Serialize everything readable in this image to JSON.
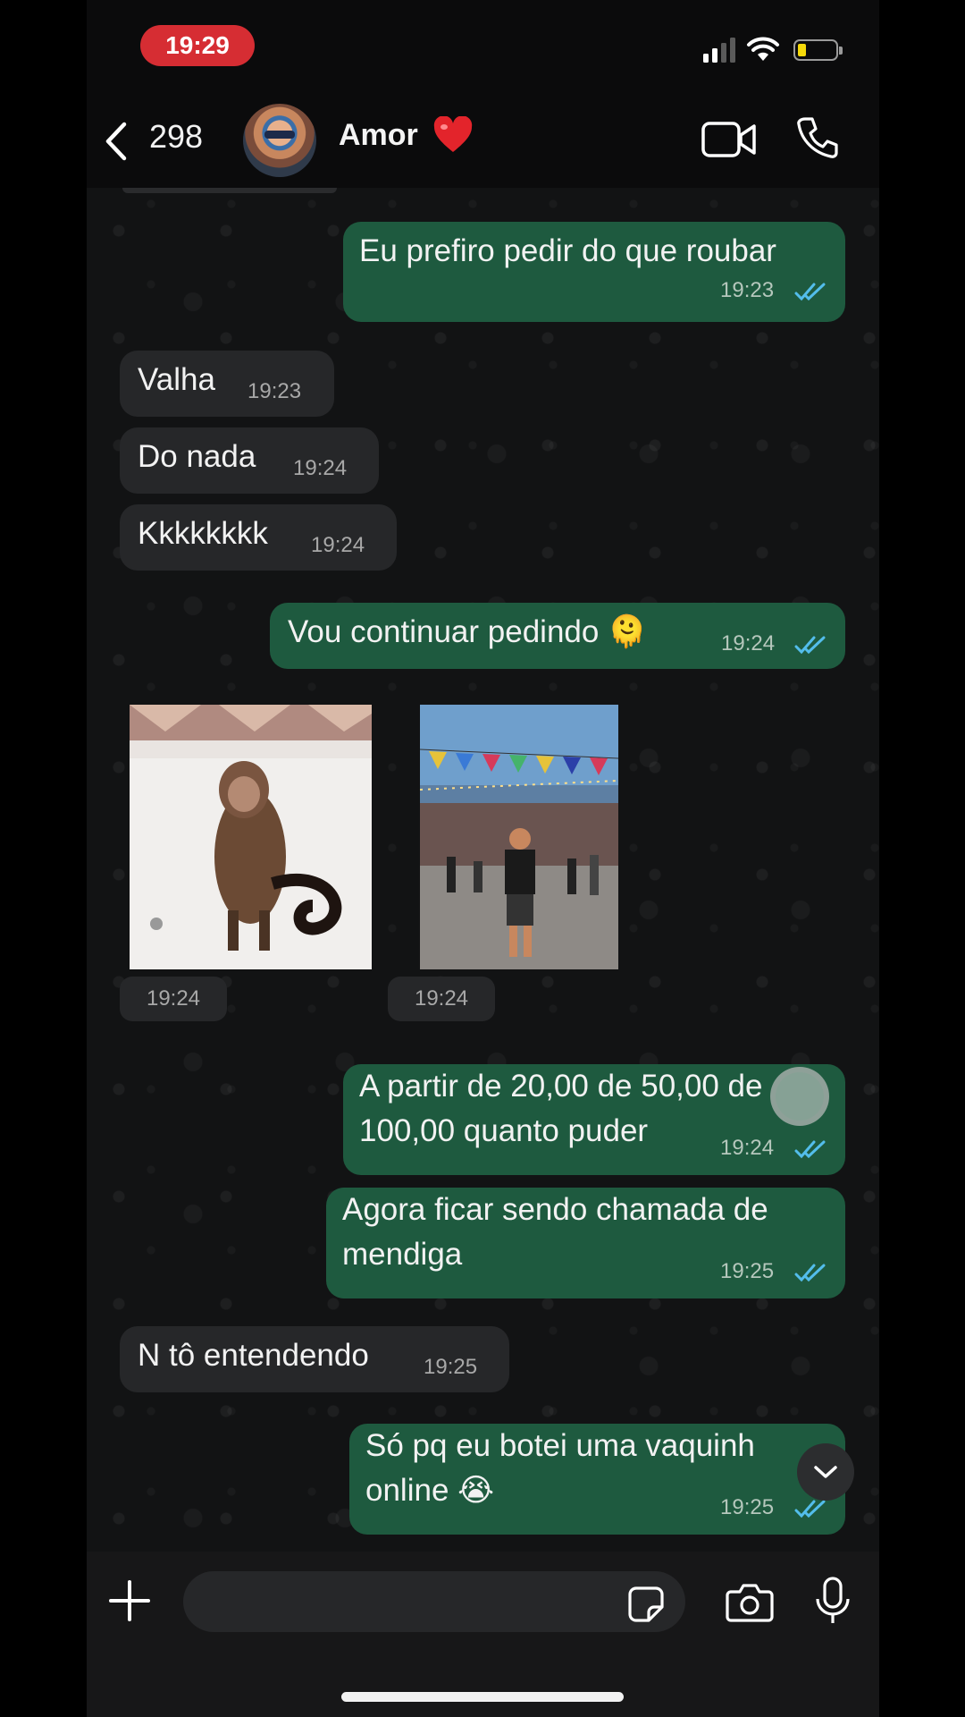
{
  "status": {
    "time": "19:29"
  },
  "header": {
    "back_count": "298",
    "contact_name": "Amor",
    "contact_emoji": "heart"
  },
  "messages": [
    {
      "dir": "out",
      "text": "Eu prefiro pedir do que roubar",
      "time": "19:23",
      "read": true
    },
    {
      "dir": "in",
      "text": "Valha",
      "time": "19:23"
    },
    {
      "dir": "in",
      "text": "Do nada",
      "time": "19:24"
    },
    {
      "dir": "in",
      "text": "Kkkkkkkk",
      "time": "19:24"
    },
    {
      "dir": "out",
      "text": "Vou continuar pedindo 🫠",
      "time": "19:24",
      "read": true
    },
    {
      "dir": "in",
      "type": "image",
      "subject": "monkey in bathtub",
      "time": "19:24"
    },
    {
      "dir": "in",
      "type": "image",
      "subject": "man at festival with bunting",
      "time": "19:24"
    },
    {
      "dir": "out",
      "text": "A partir de 20,00 de 50,00 de",
      "text2": "100,00 quanto puder",
      "time": "19:24",
      "read": true
    },
    {
      "dir": "out",
      "text": "Agora ficar sendo chamada de",
      "text2": "mendiga",
      "time": "19:25",
      "read": true
    },
    {
      "dir": "in",
      "text": "N tô entendendo",
      "time": "19:25"
    },
    {
      "dir": "out",
      "text": "Só pq eu botei uma vaquinh",
      "text2": "online 😭",
      "time": "19:25",
      "read": true
    }
  ],
  "colors": {
    "outgoing": "#1e5a3f",
    "incoming": "#262729",
    "ticks": "#53bdeb",
    "status_pill": "#d62d33",
    "battery": "#f5d90a"
  },
  "icons": [
    "back-chevron-icon",
    "video-call-icon",
    "phone-call-icon",
    "plus-icon",
    "sticker-icon",
    "camera-icon",
    "microphone-icon",
    "scroll-down-chevron-icon"
  ]
}
